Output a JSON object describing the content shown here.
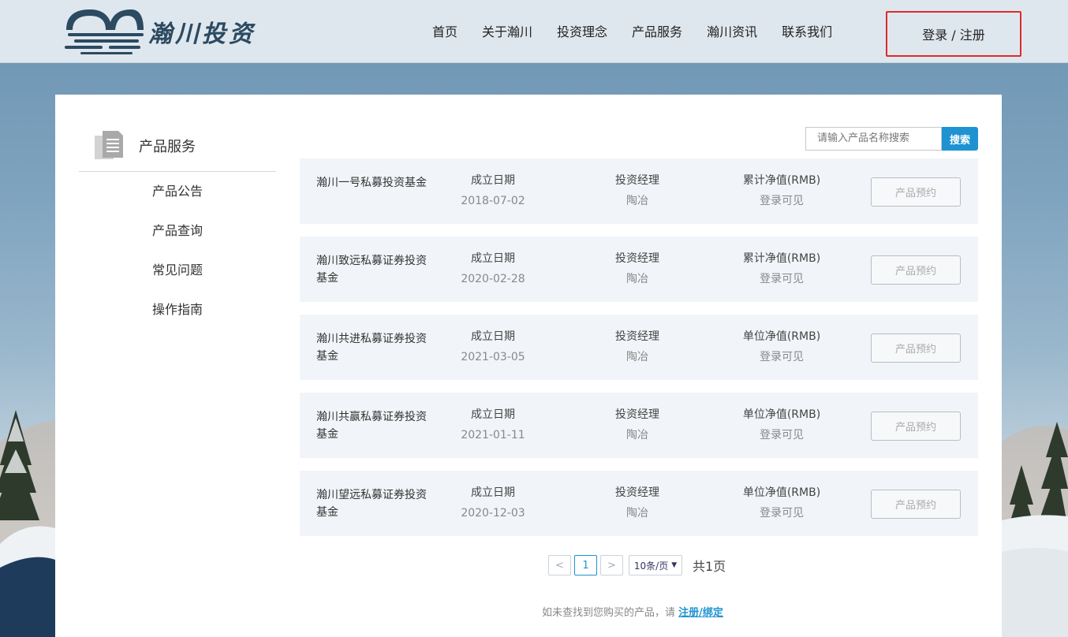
{
  "brand": {
    "name": "瀚川投资"
  },
  "nav": {
    "items": [
      "首页",
      "关于瀚川",
      "投资理念",
      "产品服务",
      "瀚川资讯",
      "联系我们"
    ],
    "login": "登录 / 注册"
  },
  "sidebar": {
    "title": "产品服务",
    "items": [
      "产品公告",
      "产品查询",
      "常见问题",
      "操作指南"
    ]
  },
  "search": {
    "placeholder": "请输入产品名称搜索",
    "button": "搜索"
  },
  "products": [
    {
      "name": "瀚川一号私募投资基金",
      "date_label": "成立日期",
      "date": "2018-07-02",
      "manager_label": "投资经理",
      "manager": "陶冶",
      "nav_label": "累计净值(RMB)",
      "nav_value": "登录可见",
      "button": "产品预约"
    },
    {
      "name": "瀚川致远私募证券投资基金",
      "date_label": "成立日期",
      "date": "2020-02-28",
      "manager_label": "投资经理",
      "manager": "陶冶",
      "nav_label": "累计净值(RMB)",
      "nav_value": "登录可见",
      "button": "产品预约"
    },
    {
      "name": "瀚川共进私募证券投资基金",
      "date_label": "成立日期",
      "date": "2021-03-05",
      "manager_label": "投资经理",
      "manager": "陶冶",
      "nav_label": "单位净值(RMB)",
      "nav_value": "登录可见",
      "button": "产品预约"
    },
    {
      "name": "瀚川共赢私募证券投资基金",
      "date_label": "成立日期",
      "date": "2021-01-11",
      "manager_label": "投资经理",
      "manager": "陶冶",
      "nav_label": "单位净值(RMB)",
      "nav_value": "登录可见",
      "button": "产品预约"
    },
    {
      "name": "瀚川望远私募证券投资基金",
      "date_label": "成立日期",
      "date": "2020-12-03",
      "manager_label": "投资经理",
      "manager": "陶冶",
      "nav_label": "单位净值(RMB)",
      "nav_value": "登录可见",
      "button": "产品预约"
    }
  ],
  "pagination": {
    "prev": "<",
    "current": "1",
    "next": ">",
    "page_size": "10条/页",
    "total": "共1页"
  },
  "footer": {
    "note": "如未查找到您购买的产品，请",
    "link": "注册/绑定"
  },
  "colors": {
    "accent": "#1f93d2",
    "login_border": "#e02a2a",
    "row_bg": "#f1f5f9"
  }
}
